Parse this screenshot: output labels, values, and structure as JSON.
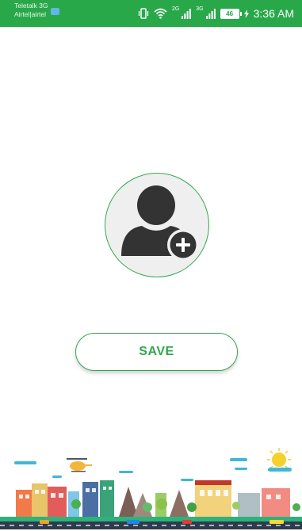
{
  "status_bar": {
    "carrier_1": "Teletalk 3G",
    "carrier_2": "Airtel|airtel",
    "net_2g": "2G",
    "net_3g": "3G",
    "battery_level": "46",
    "time": "3:36 AM"
  },
  "save_button": {
    "label": "SAVE"
  },
  "colors": {
    "status_bar": "#29a84a",
    "accent": "#2ea84c",
    "avatar_bg": "#efefef",
    "avatar_icon": "#333333"
  }
}
